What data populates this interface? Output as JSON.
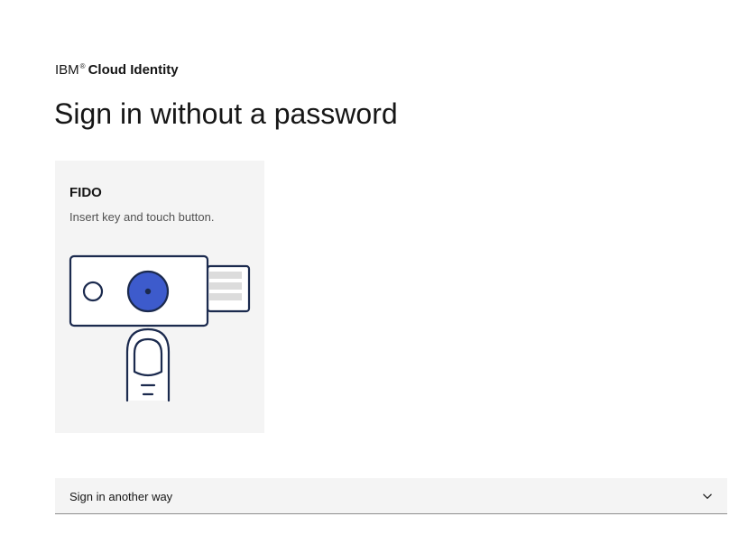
{
  "header": {
    "brand_company": "IBM",
    "brand_registered": "®",
    "brand_product": "Cloud Identity"
  },
  "main": {
    "title": "Sign in without a password",
    "fido_option": {
      "title": "FIDO",
      "description": "Insert key and touch button.",
      "icon": "fido-key-touch-icon"
    },
    "other_methods": {
      "label": "Sign in another way",
      "icon": "chevron-down-icon",
      "expanded": false
    }
  },
  "colors": {
    "accent_blue": "#3d5bcc",
    "outline_dark": "#1b2a4e",
    "tile_background": "#f4f4f4",
    "key_bars": "#dcdcdc"
  }
}
